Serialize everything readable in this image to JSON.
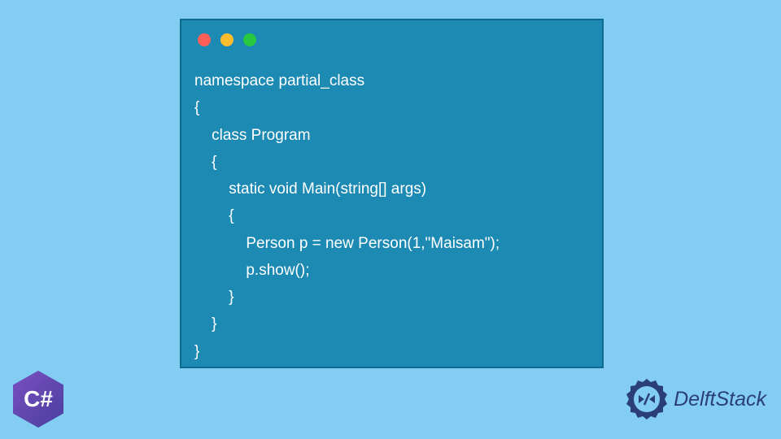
{
  "code": {
    "lines": [
      "namespace partial_class",
      "{",
      "    class Program",
      "    {",
      "        static void Main(string[] args)",
      "        {",
      "            Person p = new Person(1,\"Maisam\");",
      "            p.show();",
      "        }",
      "    }",
      "}"
    ]
  },
  "csharp_logo": {
    "text": "C#"
  },
  "delftstack": {
    "text": "DelftStack"
  }
}
